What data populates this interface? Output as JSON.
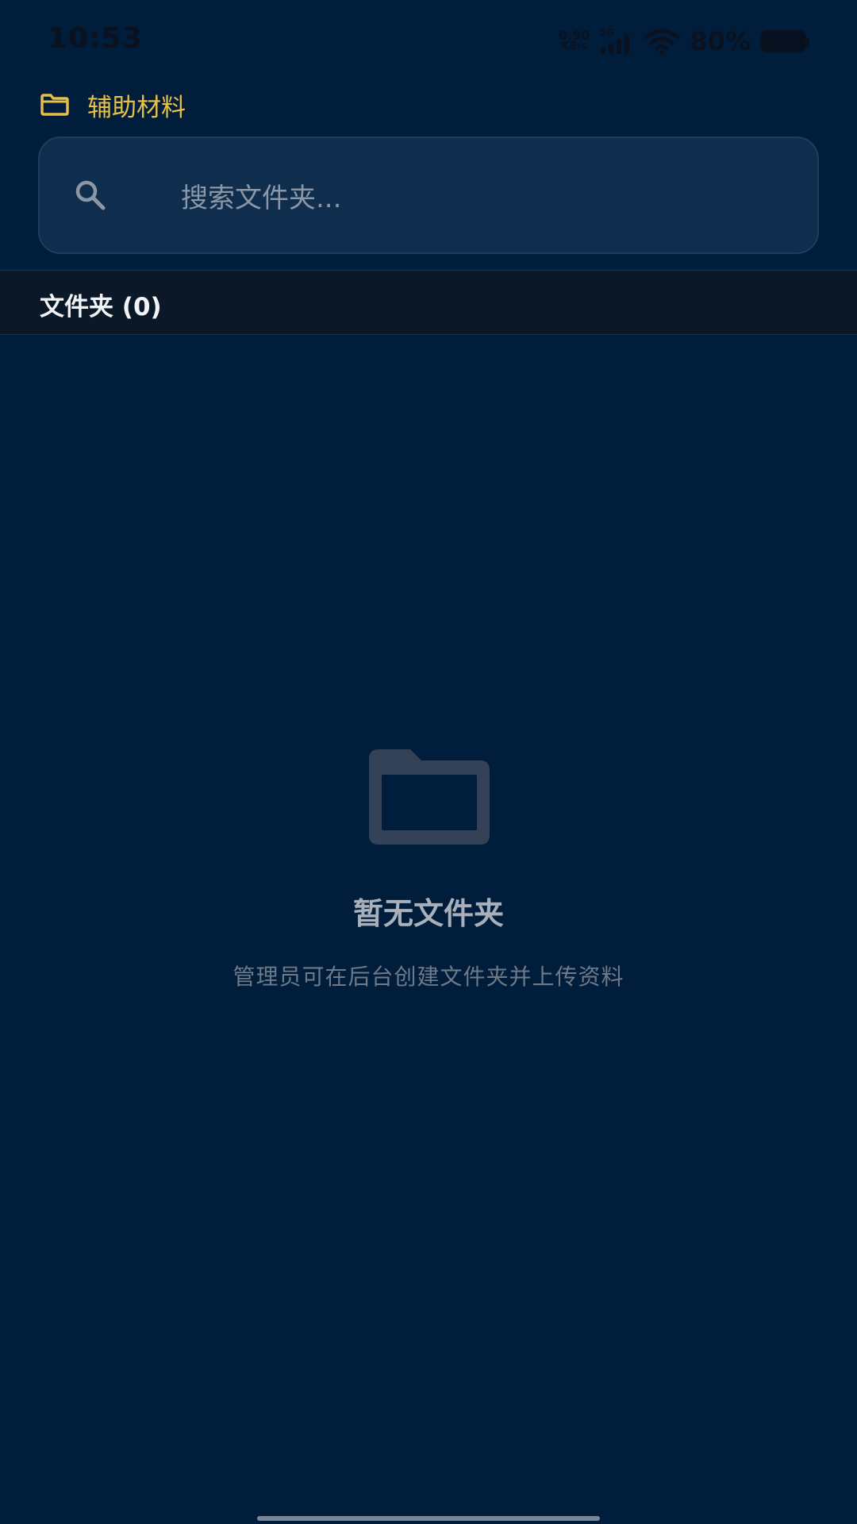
{
  "status_bar": {
    "time": "10:53",
    "net_speed_value": "0.90",
    "net_speed_unit": "KB/s",
    "network_type": "5G",
    "battery": "80%",
    "icons": [
      "signal-icon",
      "wifi-icon",
      "battery-icon"
    ]
  },
  "breadcrumb": {
    "icon": "folder-icon",
    "label": "辅助材料"
  },
  "search": {
    "icon": "search-icon",
    "placeholder": "搜索文件夹...",
    "value": ""
  },
  "section": {
    "title": "文件夹 (0)"
  },
  "empty_state": {
    "icon": "folder-icon",
    "title": "暂无文件夹",
    "subtitle": "管理员可在后台创建文件夹并上传资料"
  },
  "colors": {
    "background": "#011d3c",
    "accent": "#e7c04a",
    "search_bg": "#0f2d4c",
    "section_bg": "#0b1828"
  }
}
